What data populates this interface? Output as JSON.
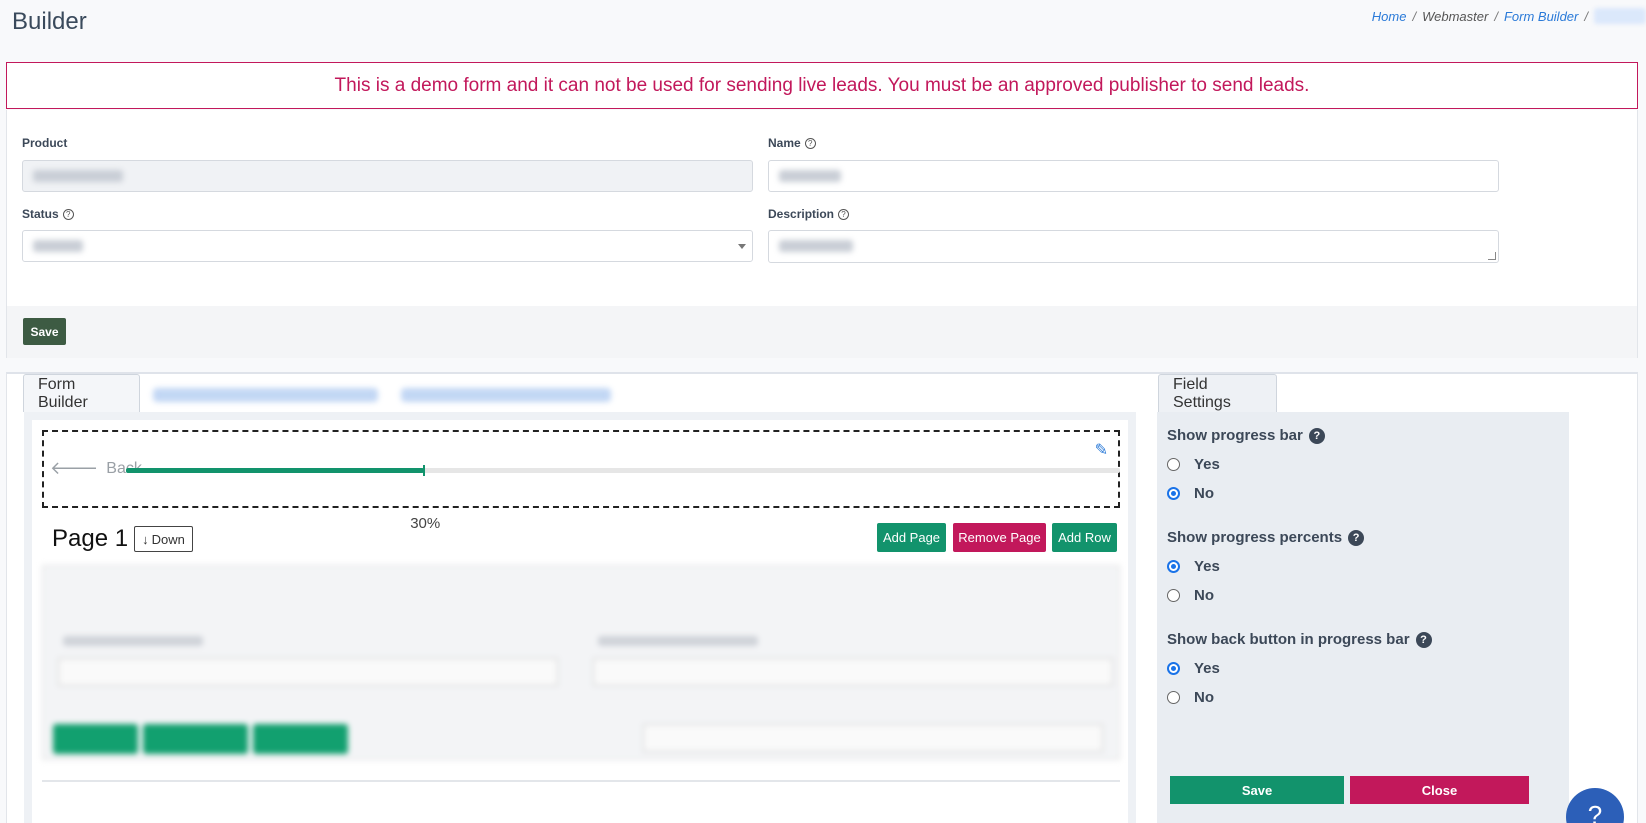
{
  "header": {
    "title": "Builder",
    "breadcrumb": [
      "Home",
      "Webmaster",
      "Form Builder"
    ]
  },
  "alert": {
    "text": "This is a demo form and it can not be used for sending live leads. You must be an approved publisher to send leads."
  },
  "form": {
    "product_label": "Product",
    "name_label": "Name",
    "status_label": "Status",
    "description_label": "Description",
    "help_glyph": "?",
    "save_label": "Save"
  },
  "tabs": {
    "form_builder": "Form Builder",
    "field_settings": "Field Settings"
  },
  "progress": {
    "back_label": "Back",
    "percent": 30,
    "percent_label": "30%"
  },
  "page": {
    "title": "Page 1",
    "down_label": "Down",
    "add_page": "Add Page",
    "remove_page": "Remove Page",
    "add_row": "Add Row"
  },
  "settings": {
    "progress_bar": {
      "label": "Show progress bar",
      "yes": "Yes",
      "no": "No",
      "selected": "No"
    },
    "progress_percents": {
      "label": "Show progress percents",
      "yes": "Yes",
      "no": "No",
      "selected": "Yes"
    },
    "back_button": {
      "label": "Show back button in progress bar",
      "yes": "Yes",
      "no": "No",
      "selected": "Yes"
    },
    "save_label": "Save",
    "close_label": "Close"
  },
  "colors": {
    "accent_green": "#12936c",
    "accent_pink": "#c2185b",
    "link_blue": "#2a7ad8",
    "save_dark": "#3d5b43"
  },
  "icons": {
    "back": "arrow-left-icon",
    "edit": "pencil-icon",
    "down": "arrow-down-icon",
    "help": "question-circle-icon",
    "support": "help-chat-icon"
  }
}
